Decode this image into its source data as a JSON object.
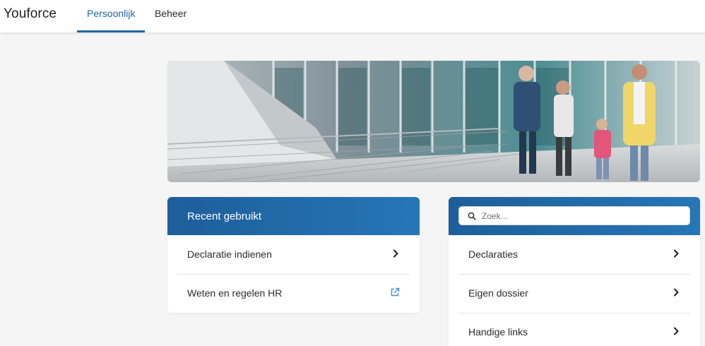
{
  "app": {
    "title": "Youforce"
  },
  "nav": {
    "tabs": [
      {
        "label": "Persoonlijk",
        "active": true
      },
      {
        "label": "Beheer",
        "active": false
      }
    ]
  },
  "recent": {
    "title": "Recent gebruikt",
    "items": [
      {
        "label": "Declaratie indienen",
        "icon": "chevron-right-icon"
      },
      {
        "label": "Weten en regelen HR",
        "icon": "external-link-icon"
      }
    ]
  },
  "search": {
    "placeholder": "Zoek...",
    "value": "",
    "items": [
      {
        "label": "Declaraties",
        "icon": "chevron-right-icon"
      },
      {
        "label": "Eigen dossier",
        "icon": "chevron-right-icon"
      },
      {
        "label": "Handige links",
        "icon": "chevron-right-icon"
      }
    ]
  },
  "colors": {
    "accent": "#2166a4",
    "header_gradient_start": "#1d5e9b",
    "header_gradient_end": "#2676b6",
    "background": "#f5f5f5"
  }
}
